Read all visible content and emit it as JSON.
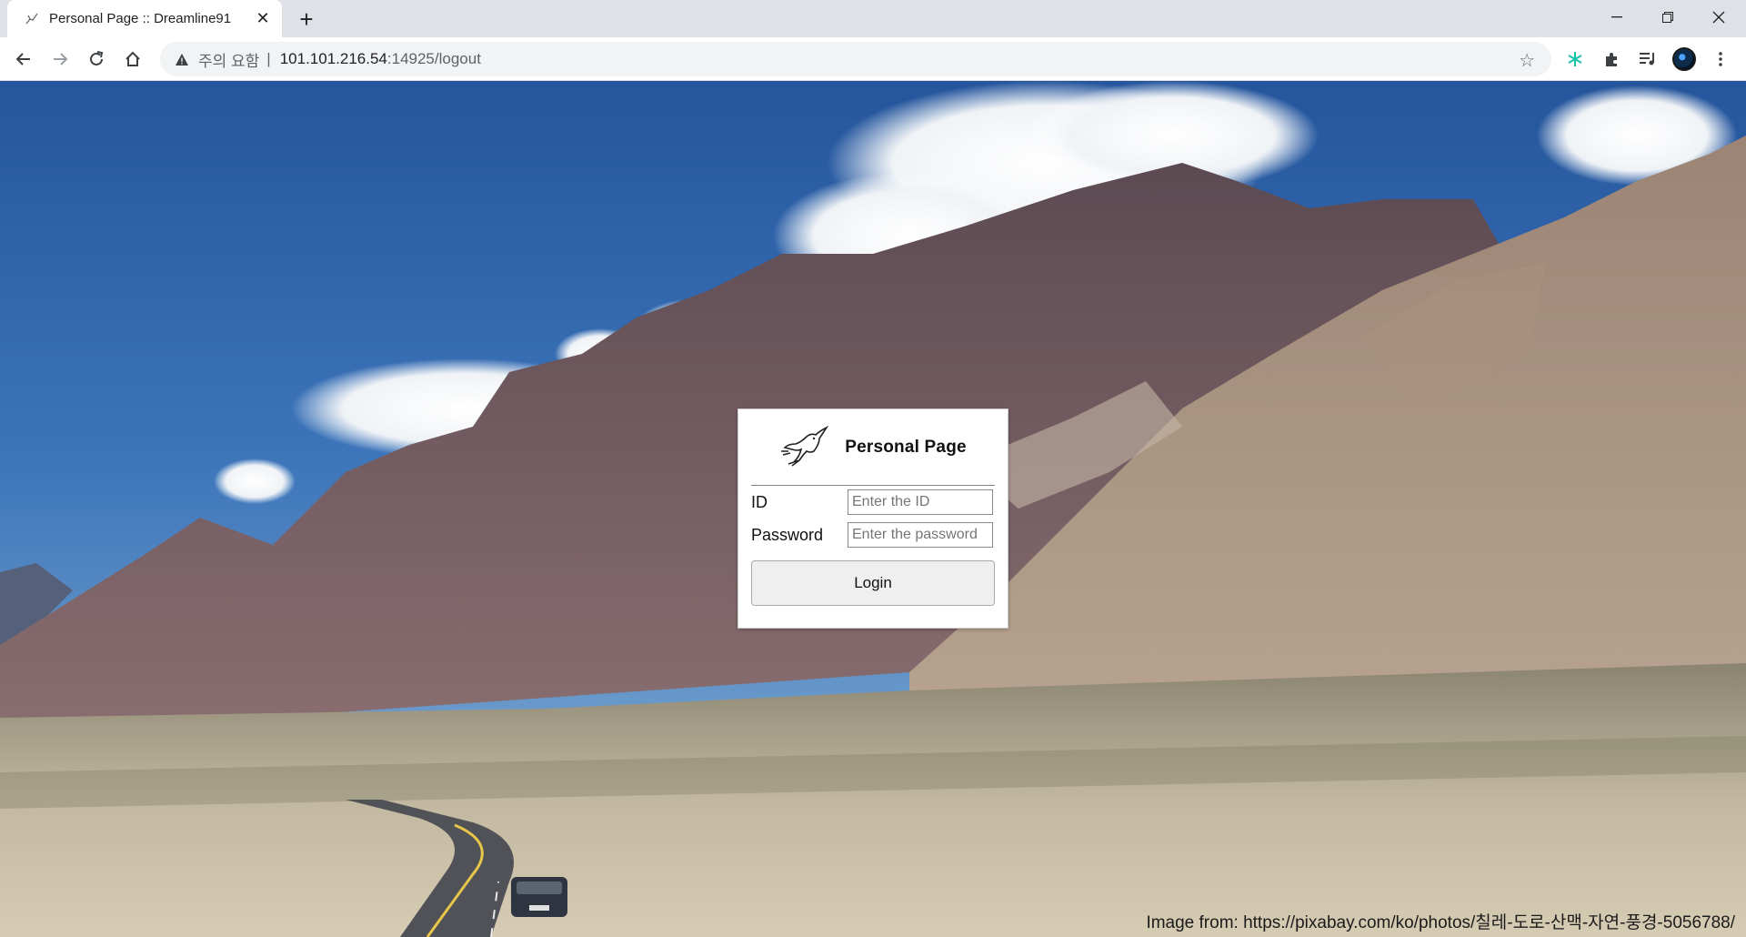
{
  "browser": {
    "tab_title": "Personal Page :: Dreamline91",
    "security_warning": "주의 요함",
    "separator": "|",
    "url_host": "101.101.216.54",
    "url_path": ":14925/logout"
  },
  "login": {
    "title": "Personal Page",
    "id_label": "ID",
    "id_placeholder": "Enter the ID",
    "password_label": "Password",
    "password_placeholder": "Enter the password",
    "button_label": "Login"
  },
  "footer": {
    "credit": "Image from: https://pixabay.com/ko/photos/칠레-도로-산맥-자연-풍경-5056788/"
  }
}
